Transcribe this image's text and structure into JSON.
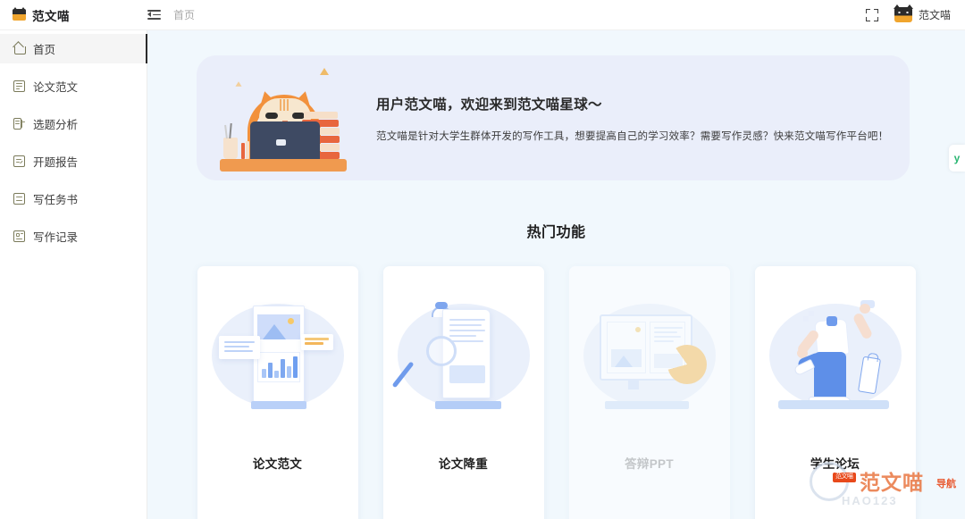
{
  "topbar": {
    "brand_name": "范文喵",
    "logo_icon": "cat-logo-icon",
    "collapse_icon": "menu-collapse-icon",
    "breadcrumb": "首页",
    "fullscreen_icon": "fullscreen-icon",
    "avatar_icon": "cat-avatar-icon",
    "user_name": "范文喵"
  },
  "sidebar": {
    "items": [
      {
        "label": "首页",
        "icon": "home-icon",
        "active": true
      },
      {
        "label": "论文范文",
        "icon": "document-icon",
        "active": false
      },
      {
        "label": "选题分析",
        "icon": "analysis-icon",
        "active": false
      },
      {
        "label": "开题报告",
        "icon": "report-icon",
        "active": false
      },
      {
        "label": "写任务书",
        "icon": "task-book-icon",
        "active": false
      },
      {
        "label": "写作记录",
        "icon": "writing-record-icon",
        "active": false
      }
    ]
  },
  "banner": {
    "title": "用户范文喵，欢迎来到范文喵星球～",
    "subtitle": "范文喵是针对大学生群体开发的写作工具，想要提高自己的学习效率？需要写作灵感？快来范文喵写作平台吧！",
    "illustration": "cat-with-laptop-illustration",
    "background_color": "#eaeefa",
    "side_tab_label": "y",
    "side_tab_color": "#2bb673"
  },
  "section": {
    "title": "热门功能"
  },
  "cards": [
    {
      "label": "论文范文",
      "illustration": "document-chart-illustration",
      "disabled": false
    },
    {
      "label": "论文降重",
      "illustration": "scroll-magnifier-illustration",
      "disabled": false
    },
    {
      "label": "答辩PPT",
      "illustration": "presentation-screen-illustration",
      "disabled": true
    },
    {
      "label": "学生论坛",
      "illustration": "student-celebrating-illustration",
      "disabled": false
    }
  ],
  "watermark": {
    "badge": "范文喵",
    "main": "范文喵",
    "nav": "导航",
    "sub": "HAO123",
    "accent_color": "#e8713a"
  },
  "theme": {
    "main_background": "#f1f8fd",
    "sidebar_background": "#ffffff",
    "card_background": "#ffffff",
    "accent_orange": "#f2913c"
  }
}
